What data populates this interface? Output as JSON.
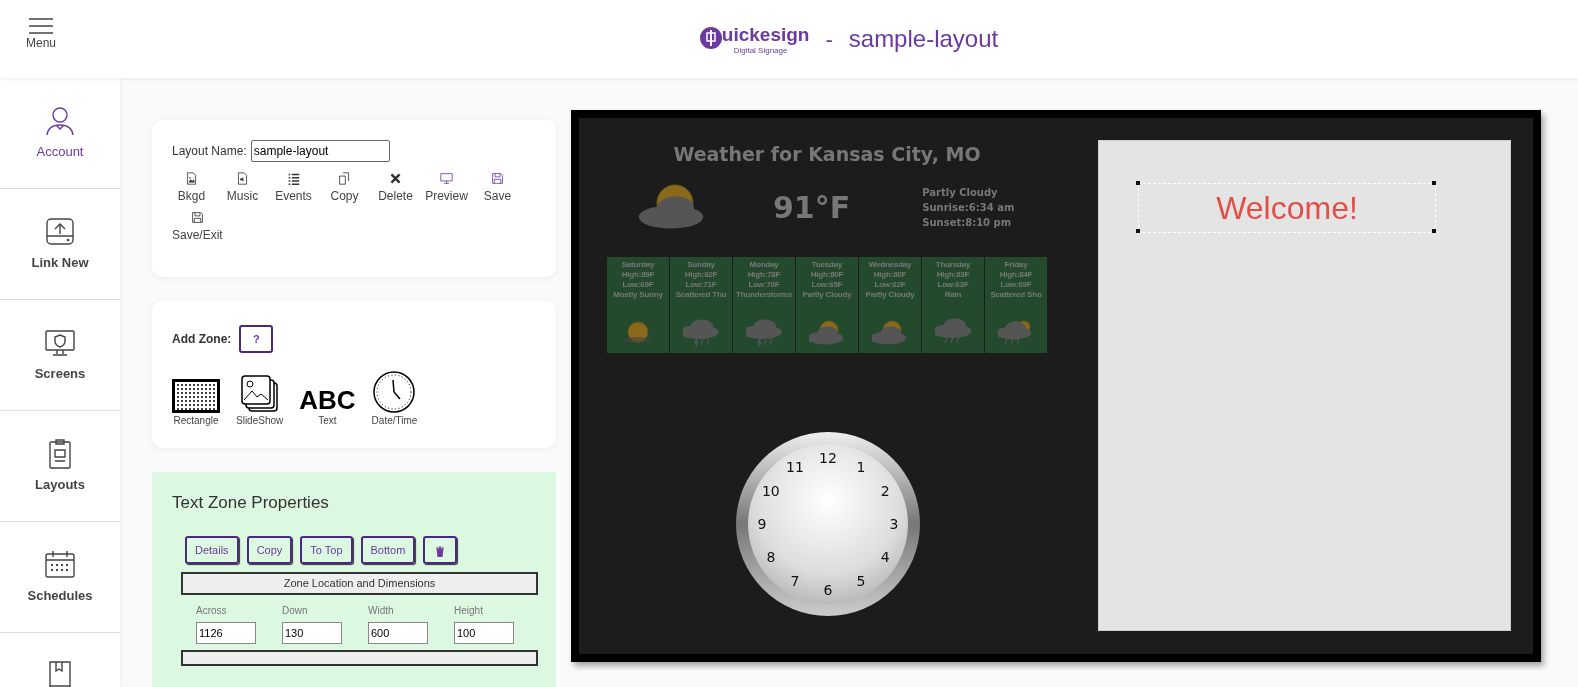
{
  "header": {
    "menu_label": "Menu",
    "logo_wordmark": "uickesign",
    "logo_tagline": "Digital Signage",
    "separator": "-",
    "title": "sample-layout"
  },
  "sidebar": {
    "items": [
      {
        "label": "Account",
        "selected": true
      },
      {
        "label": "Link New",
        "selected": false
      },
      {
        "label": "Screens",
        "selected": false
      },
      {
        "label": "Layouts",
        "selected": false
      },
      {
        "label": "Schedules",
        "selected": false
      }
    ]
  },
  "layout_card": {
    "name_label": "Layout Name:",
    "name_value": "sample-layout",
    "tools": [
      "Bkgd",
      "Music",
      "Events",
      "Copy",
      "Delete",
      "Preview",
      "Save",
      "Save/Exit"
    ]
  },
  "zone_card": {
    "label": "Add Zone:",
    "help_button": "?",
    "zone_types": [
      {
        "kind": "rectangle",
        "label": "Rectangle"
      },
      {
        "kind": "slideshow",
        "label": "SlideShow"
      },
      {
        "kind": "text",
        "label": "Text",
        "sample": "ABC"
      },
      {
        "kind": "datetime",
        "label": "Date/Time"
      }
    ]
  },
  "properties": {
    "title": "Text Zone Properties",
    "buttons": [
      "Details",
      "Copy",
      "To Top",
      "Bottom"
    ],
    "section": "Zone Location and Dimensions",
    "fields": [
      {
        "label": "Across",
        "value": "1126"
      },
      {
        "label": "Down",
        "value": "130"
      },
      {
        "label": "Width",
        "value": "600"
      },
      {
        "label": "Height",
        "value": "100"
      }
    ]
  },
  "canvas": {
    "weather": {
      "title": "Weather for Kansas City, MO",
      "temperature": "91°F",
      "conditions": [
        "Partly Cloudy",
        "Sunrise:6:34 am",
        "Sunset:8:10 pm"
      ],
      "days": [
        {
          "day": "Saturday",
          "high": "High:89F",
          "low": "Low:69F",
          "summary": "Mostly Sunny",
          "kind": "sunny"
        },
        {
          "day": "Sunday",
          "high": "High:82F",
          "low": "Low:71F",
          "summary": "Scattered Thu",
          "kind": "storm"
        },
        {
          "day": "Monday",
          "high": "High:78F",
          "low": "Low:70F",
          "summary": "Thunderstorms",
          "kind": "storm"
        },
        {
          "day": "Tuesday",
          "high": "High:80F",
          "low": "Low:65F",
          "summary": "Partly Cloudy",
          "kind": "partly"
        },
        {
          "day": "Wednesday",
          "high": "High:80F",
          "low": "Low:62F",
          "summary": "Partly Cloudy",
          "kind": "partly"
        },
        {
          "day": "Thursday",
          "high": "High:83F",
          "low": "Low:63F",
          "summary": "Rain",
          "kind": "rain"
        },
        {
          "day": "Friday",
          "high": "High:84F",
          "low": "Low:69F",
          "summary": "Scattered Sho",
          "kind": "showers"
        }
      ]
    },
    "clock": {
      "numbers": [
        "12",
        "1",
        "2",
        "3",
        "4",
        "5",
        "6",
        "7",
        "8",
        "9",
        "10",
        "11"
      ]
    },
    "text_zone": {
      "text": "Welcome!",
      "selected": true
    }
  }
}
